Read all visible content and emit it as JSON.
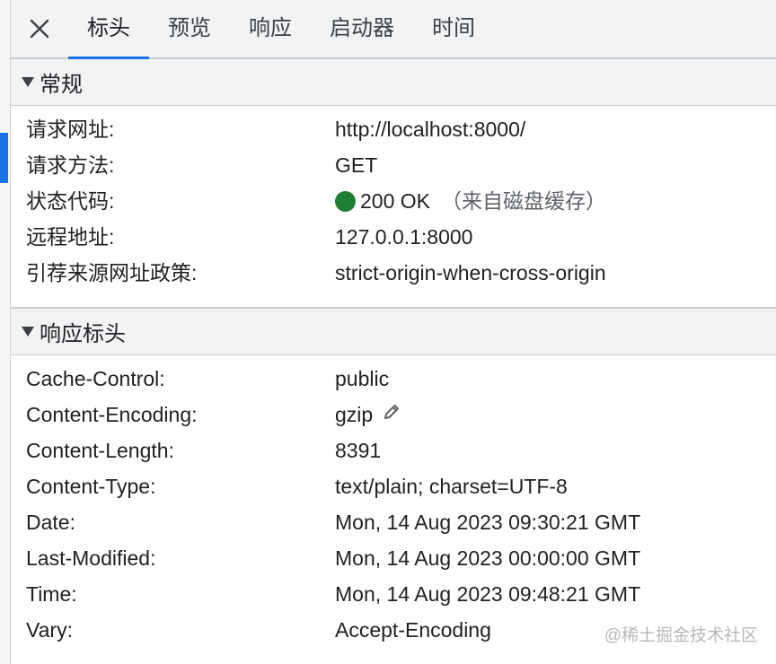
{
  "tabs": {
    "close_icon": "close-icon",
    "items": [
      {
        "label": "标头"
      },
      {
        "label": "预览"
      },
      {
        "label": "响应"
      },
      {
        "label": "启动器"
      },
      {
        "label": "时间"
      }
    ],
    "active_index": 0
  },
  "general": {
    "title": "常规",
    "rows": [
      {
        "key": "请求网址:",
        "value": "http://localhost:8000/"
      },
      {
        "key": "请求方法:",
        "value": "GET"
      },
      {
        "key": "状态代码:",
        "value": "200 OK",
        "note": "（来自磁盘缓存）"
      },
      {
        "key": "远程地址:",
        "value": "127.0.0.1:8000"
      },
      {
        "key": "引荐来源网址政策:",
        "value": "strict-origin-when-cross-origin"
      }
    ]
  },
  "response_headers": {
    "title": "响应标头",
    "rows": [
      {
        "key": "Cache-Control:",
        "value": "public"
      },
      {
        "key": "Content-Encoding:",
        "value": "gzip"
      },
      {
        "key": "Content-Length:",
        "value": "8391"
      },
      {
        "key": "Content-Type:",
        "value": "text/plain; charset=UTF-8"
      },
      {
        "key": "Date:",
        "value": "Mon, 14 Aug 2023 09:30:21 GMT"
      },
      {
        "key": "Last-Modified:",
        "value": "Mon, 14 Aug 2023 00:00:00 GMT"
      },
      {
        "key": "Time:",
        "value": "Mon, 14 Aug 2023 09:48:21 GMT"
      },
      {
        "key": "Vary:",
        "value": "Accept-Encoding"
      }
    ]
  },
  "colors": {
    "accent": "#1a73e8",
    "status_ok": "#1e7e34",
    "header_bg": "#f1f3f4"
  },
  "watermark": "@稀土掘金技术社区"
}
